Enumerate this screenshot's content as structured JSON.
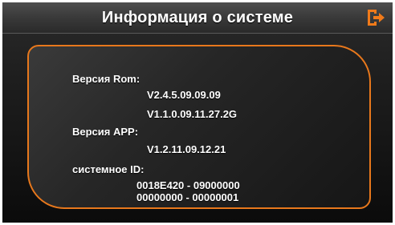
{
  "window": {
    "title": "Информация о системе",
    "exit_icon": "exit-icon",
    "accent_color": "#e8781c"
  },
  "info": {
    "rom_label": "Версия Rom:",
    "rom_values": [
      "V2.4.5.09.09.09",
      "V1.1.0.09.11.27.2G"
    ],
    "app_label": "Версия APP:",
    "app_value": "V1.2.11.09.12.21",
    "id_label": "системное ID:",
    "id_values": [
      "0018E420 - 09000000",
      "00000000 - 00000001"
    ]
  }
}
